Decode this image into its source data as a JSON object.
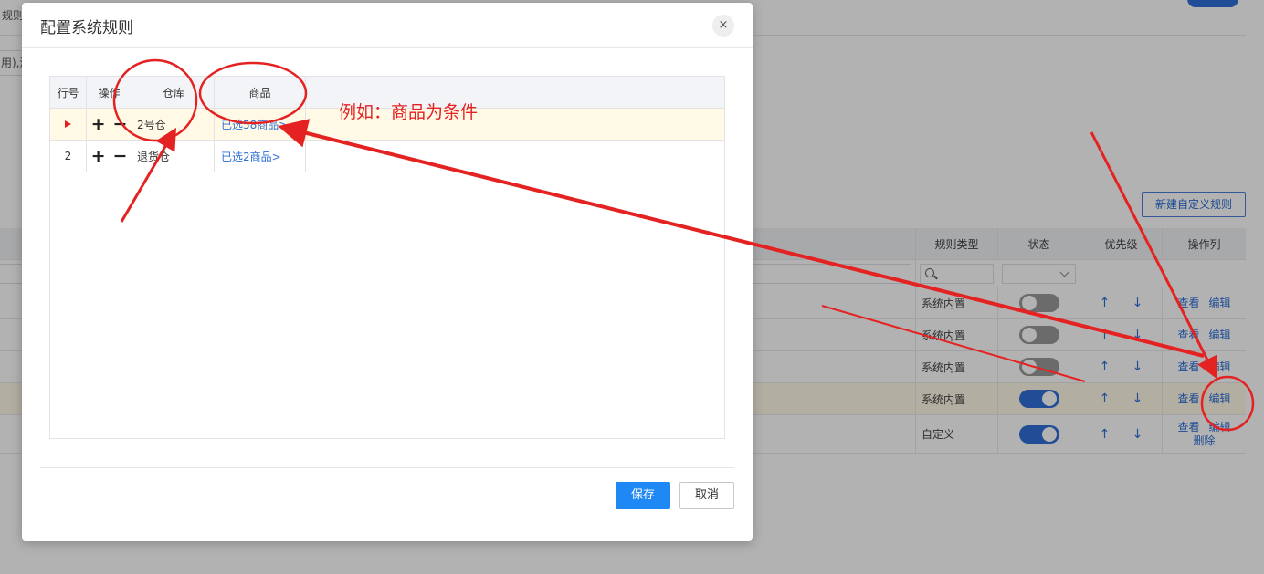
{
  "background": {
    "top_left_fragment": "规则",
    "input_fragment": "用),添",
    "new_rule_button": "新建自定义规则",
    "table": {
      "headers": {
        "rule_type": "规则类型",
        "state": "状态",
        "priority": "优先级",
        "ops": "操作列"
      },
      "rows": [
        {
          "rule_type": "系统内置",
          "enabled": false,
          "ops": [
            "查看",
            "编辑"
          ],
          "highlight": false
        },
        {
          "rule_type": "系统内置",
          "enabled": false,
          "ops": [
            "查看",
            "编辑"
          ],
          "highlight": false
        },
        {
          "rule_type": "系统内置",
          "enabled": false,
          "ops": [
            "查看",
            "编辑"
          ],
          "highlight": false
        },
        {
          "rule_type": "系统内置",
          "enabled": true,
          "ops": [
            "查看",
            "编辑"
          ],
          "highlight": true
        },
        {
          "rule_type": "自定义",
          "enabled": true,
          "ops": [
            "查看",
            "编辑",
            "删除"
          ],
          "highlight": false
        }
      ],
      "arrow_up": "↑",
      "arrow_down": "↓"
    }
  },
  "modal": {
    "title": "配置系统规则",
    "close_symbol": "×",
    "grid": {
      "headers": {
        "row_no": "行号",
        "ops": "操作",
        "warehouse": "仓库",
        "product": "商品"
      },
      "rows": [
        {
          "row_no": "",
          "current": true,
          "warehouse": "2号仓",
          "product": "已选58商品>"
        },
        {
          "row_no": "2",
          "current": false,
          "warehouse": "退货仓",
          "product": "已选2商品>"
        }
      ],
      "add_symbol": "+",
      "remove_symbol": "−"
    },
    "save_label": "保存",
    "cancel_label": "取消"
  },
  "annotation": {
    "text": "例如：商品为条件",
    "color": "#e52222"
  }
}
